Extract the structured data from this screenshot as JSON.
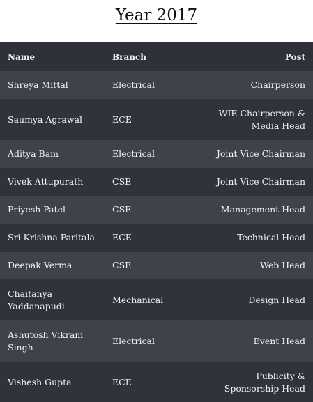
{
  "title": "Year 2017",
  "columns": {
    "name": "Name",
    "branch": "Branch",
    "post": "Post"
  },
  "rows": [
    {
      "name": "Shreya Mittal",
      "branch": "Electrical",
      "post": "Chairperson"
    },
    {
      "name": "Saumya Agrawal",
      "branch": "ECE",
      "post_line1": "WIE Chairperson &",
      "post_line2": "Media Head"
    },
    {
      "name": "Aditya Bam",
      "branch": "Electrical",
      "post": "Joint Vice Chairman"
    },
    {
      "name": "Vivek Attupurath",
      "branch": "CSE",
      "post": "Joint Vice Chairman"
    },
    {
      "name": "Priyesh Patel",
      "branch": "CSE",
      "post": "Management Head"
    },
    {
      "name": "Sri Krishna Paritala",
      "branch": "ECE",
      "post": "Technical Head"
    },
    {
      "name": "Deepak Verma",
      "branch": "CSE",
      "post": "Web Head"
    },
    {
      "name_line1": "Chaitanya",
      "name_line2": "Yaddanapudi",
      "branch": "Mechanical",
      "post": "Design Head"
    },
    {
      "name_line1": "Ashutosh Vikram",
      "name_line2": "Singh",
      "branch": "Electrical",
      "post": "Event Head"
    },
    {
      "name": "Vishesh Gupta",
      "branch": "ECE",
      "post_line1": "Publicity &",
      "post_line2": "Sponsorship Head"
    }
  ],
  "colors": {
    "header_bg": "#2e3238",
    "row_light": "#3e434a",
    "row_dark": "#30343a",
    "text": "#f2f2f2"
  }
}
